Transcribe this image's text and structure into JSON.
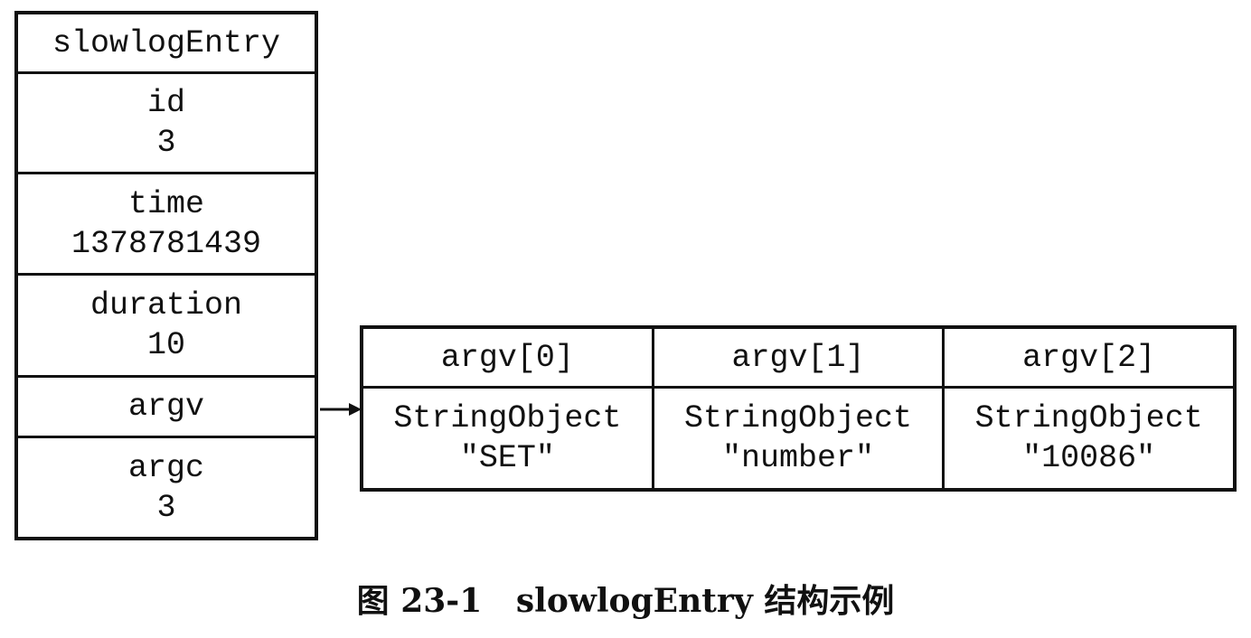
{
  "slowlog_entry": {
    "title": "slowlogEntry",
    "fields": {
      "id": {
        "name": "id",
        "value": "3"
      },
      "time": {
        "name": "time",
        "value": "1378781439"
      },
      "duration": {
        "name": "duration",
        "value": "10"
      },
      "argv": {
        "name": "argv"
      },
      "argc": {
        "name": "argc",
        "value": "3"
      }
    }
  },
  "argv_array": [
    {
      "header": "argv[0]",
      "type": "StringObject",
      "value": "\"SET\""
    },
    {
      "header": "argv[1]",
      "type": "StringObject",
      "value": "\"number\""
    },
    {
      "header": "argv[2]",
      "type": "StringObject",
      "value": "\"10086\""
    }
  ],
  "caption": "图 23-1   slowlogEntry 结构示例",
  "colors": {
    "stroke": "#111111",
    "background": "#ffffff"
  }
}
